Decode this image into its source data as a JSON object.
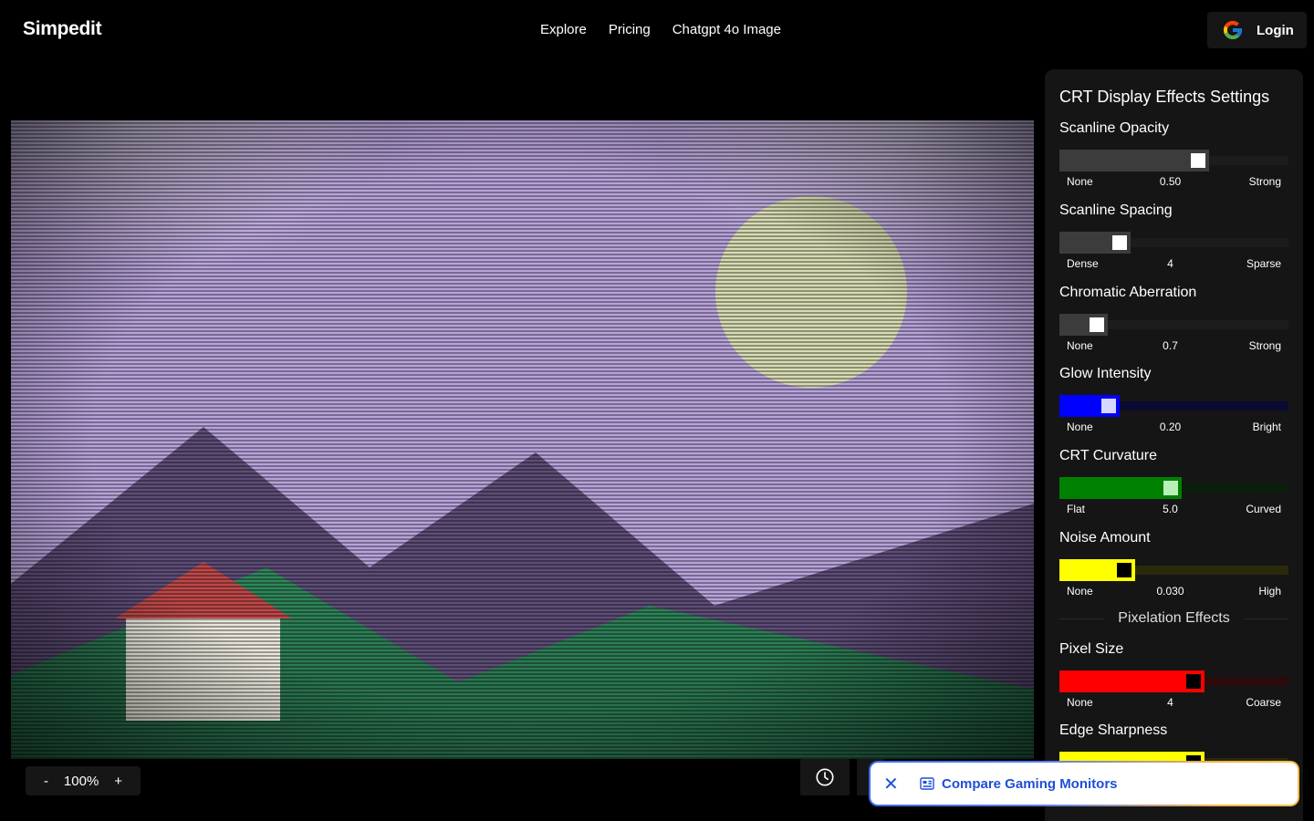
{
  "header": {
    "logo": "Simpedit",
    "nav": [
      "Explore",
      "Pricing",
      "Chatgpt 4o Image"
    ],
    "login_label": "Login"
  },
  "zoom": {
    "minus": "-",
    "level": "100%",
    "plus": "+"
  },
  "panel": {
    "title": "CRT Display Effects Settings",
    "settings": [
      {
        "label": "Scanline Opacity",
        "min": "None",
        "value": "0.50",
        "max": "Strong",
        "level": 0.62,
        "fill_color": "#3c3c3c",
        "track_color": "#1c1c1c",
        "thumb_color": "#ffffff"
      },
      {
        "label": "Scanline Spacing",
        "min": "Dense",
        "value": "4",
        "max": "Sparse",
        "level": 0.28,
        "fill_color": "#3c3c3c",
        "track_color": "#1c1c1c",
        "thumb_color": "#ffffff"
      },
      {
        "label": "Chromatic Aberration",
        "min": "None",
        "value": "0.7",
        "max": "Strong",
        "level": 0.18,
        "fill_color": "#3c3c3c",
        "track_color": "#1c1c1c",
        "thumb_color": "#ffffff"
      },
      {
        "label": "Glow Intensity",
        "min": "None",
        "value": "0.20",
        "max": "Bright",
        "level": 0.23,
        "fill_color": "#0000ff",
        "track_color": "#0a0a33",
        "thumb_color": "#d6d6ff"
      },
      {
        "label": "CRT Curvature",
        "min": "Flat",
        "value": "5.0",
        "max": "Curved",
        "level": 0.5,
        "fill_color": "#008000",
        "track_color": "#0b1d0b",
        "thumb_color": "#b8f0b8"
      },
      {
        "label": "Noise Amount",
        "min": "None",
        "value": "0.030",
        "max": "High",
        "level": 0.3,
        "fill_color": "#ffff00",
        "track_color": "#2a2a0a",
        "thumb_color": "#000000"
      },
      {
        "label": "Pixel Size",
        "min": "None",
        "value": "4",
        "max": "Coarse",
        "level": 0.6,
        "fill_color": "#ff0000",
        "track_color": "#2a0a0a",
        "thumb_color": "#000000"
      },
      {
        "label": "Edge Sharpness",
        "min": "",
        "value": "",
        "max": "",
        "level": 0.6,
        "fill_color": "#ffff00",
        "track_color": "#2a2a0a",
        "thumb_color": "#000000"
      }
    ],
    "section_divider": "Pixelation Effects"
  },
  "popup": {
    "close": "✕",
    "label": "Compare Gaming Monitors"
  },
  "icons": {
    "google": "google-g-icon",
    "history": "clock-icon",
    "popup": "newspaper-icon",
    "close": "close-icon"
  },
  "colors": {
    "sky": "#b8a3dc",
    "sun": "#d8dcb2",
    "mountain": "#5e4d78",
    "hill": "#2f8a5c",
    "roof": "#c04848",
    "house": "#e9e6dc"
  }
}
